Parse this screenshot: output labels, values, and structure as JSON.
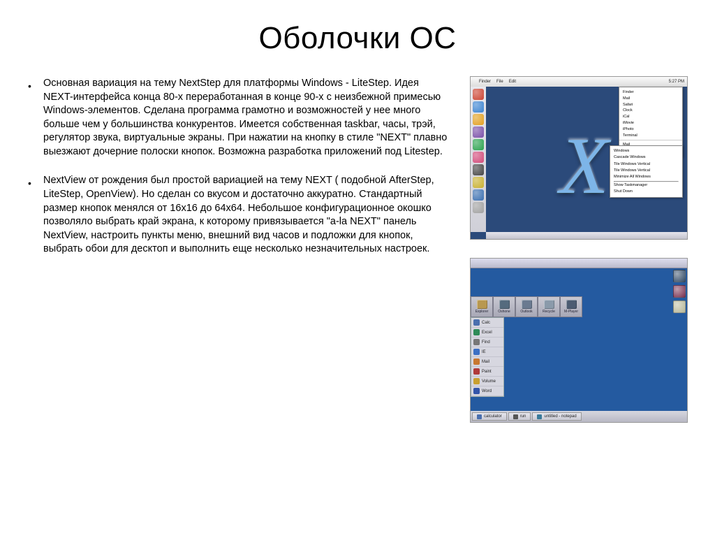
{
  "title": "Оболочки ОС",
  "bullets": [
    "Основная вариация на тему NextStep для платформы Windows - LiteStep. Идея NEXT-интерфейса конца 80-х переработанная в конце 90-х с неизбежной примесью Windows-элементов. Сделана программа грамотно и возможностей у нее много больше чем у большинства конкурентов. Имеется собственная taskbar, часы, трэй, регулятор звука, виртуальные экраны. При нажатии на кнопку в стиле \"NEXT\"  плавно выезжают дочерние полоски кнопок. Возможна разработка приложений под Litestep.",
    "NextView от рождения был простой вариацией на тему NEXT ( подобной AfterStep, LiteStep, OpenView). Но сделан со вкусом и достаточно аккуратно. Стандартный размер кнопок менялся от 16х16 до 64х64. Небольшое конфигурационное окошко позволяло выбрать край экрана, к которому привязывается \"a-la NEXT\" панель NextView, настроить пункты меню, внешний вид часов и подложки для кнопок, выбрать обои для десктоп и выполнить еще несколько незначительных настроек."
  ],
  "shot1": {
    "big_letter": "X",
    "clock": "5:27 PM",
    "menu1": [
      "Finder",
      "Mail",
      "Safari",
      "Clock",
      "iCal",
      "iMovie",
      "iPhoto",
      "Terminal",
      "",
      "Mail",
      "File"
    ],
    "menu2": [
      "Windows",
      "Cascade Windows",
      "Tile Windows Vertical",
      "Tile Windows Vertical",
      "Minimize All Windows",
      "",
      "Show Taskmanager",
      "Shut Down"
    ]
  },
  "shot2": {
    "dock": [
      "Explorer",
      "Oshone",
      "Outlook",
      "Recycle",
      "M-Player"
    ],
    "left_items": [
      "Calc",
      "Excel",
      "Find",
      "IE",
      "Mail",
      "Paint",
      "Volume",
      "Word"
    ],
    "taskbar": [
      "calculator",
      "run",
      "untitled - notepad"
    ]
  }
}
